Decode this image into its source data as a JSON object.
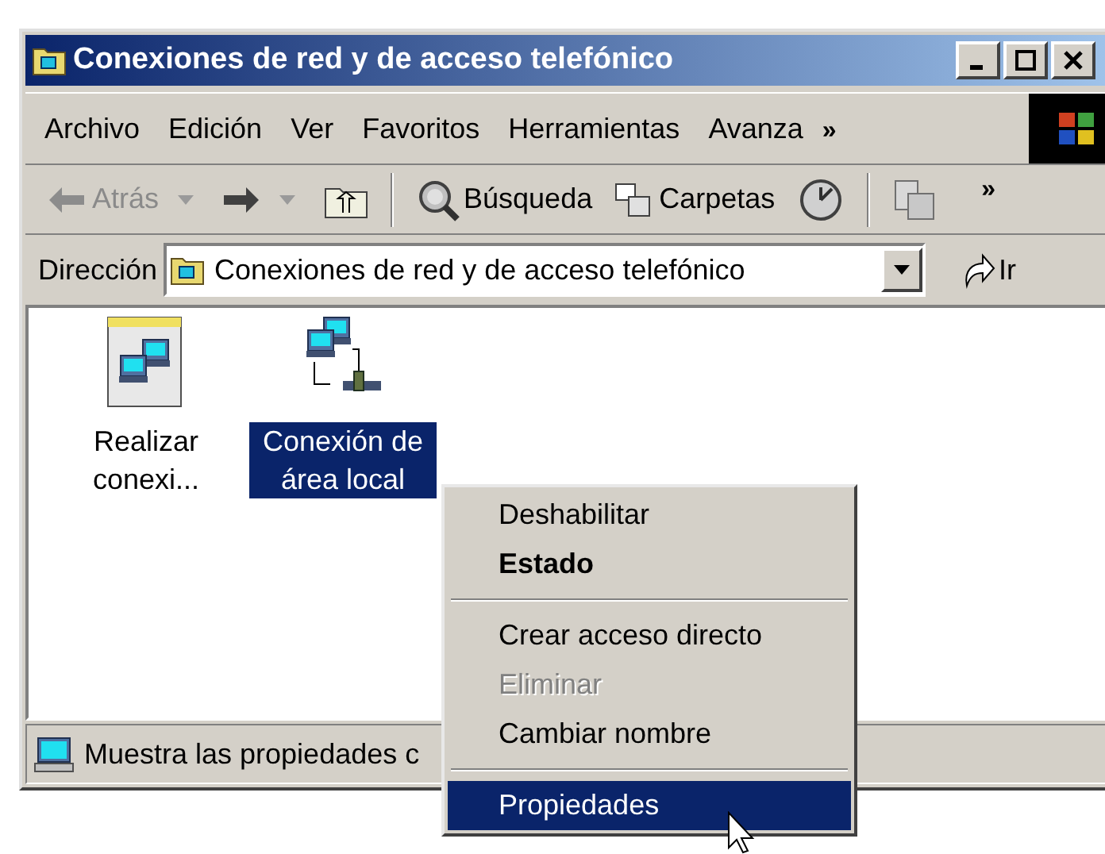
{
  "window": {
    "title": "Conexiones de red y de acceso telefónico"
  },
  "menu_bar": {
    "items": [
      "Archivo",
      "Edición",
      "Ver",
      "Favoritos",
      "Herramientas",
      "Avanza"
    ],
    "overflow": "»"
  },
  "toolbar": {
    "items": [
      {
        "kind": "back",
        "label": "Atrás",
        "disabled": true
      },
      {
        "kind": "forward",
        "disabled": false
      },
      {
        "kind": "up"
      },
      {
        "kind": "separator"
      },
      {
        "kind": "search",
        "label": "Búsqueda"
      },
      {
        "kind": "folders",
        "label": "Carpetas"
      },
      {
        "kind": "history"
      },
      {
        "kind": "separator"
      },
      {
        "kind": "move"
      }
    ],
    "overflow": "»"
  },
  "address_bar": {
    "label": "Dirección",
    "value": "Conexiones de red y de acceso telefónico",
    "go": "Ir"
  },
  "icons": [
    {
      "kind": "dialup",
      "label": "Realizar conexi...",
      "selected": false
    },
    {
      "kind": "lan",
      "label": "Conexión de área local",
      "selected": true
    }
  ],
  "status_bar": {
    "text": "Muestra las propiedades c"
  },
  "context_menu": {
    "items": [
      {
        "kind": "item",
        "label": "Deshabilitar",
        "bold": false,
        "disabled": false,
        "selected": false
      },
      {
        "kind": "item",
        "label": "Estado",
        "bold": true,
        "disabled": false,
        "selected": false
      },
      {
        "kind": "separator"
      },
      {
        "kind": "item",
        "label": "Crear acceso directo",
        "bold": false,
        "disabled": false,
        "selected": false
      },
      {
        "kind": "item",
        "label": "Eliminar",
        "bold": false,
        "disabled": true,
        "selected": false
      },
      {
        "kind": "item",
        "label": "Cambiar nombre",
        "bold": false,
        "disabled": false,
        "selected": false
      },
      {
        "kind": "separator"
      },
      {
        "kind": "item",
        "label": "Propiedades",
        "bold": false,
        "disabled": false,
        "selected": true
      }
    ]
  }
}
